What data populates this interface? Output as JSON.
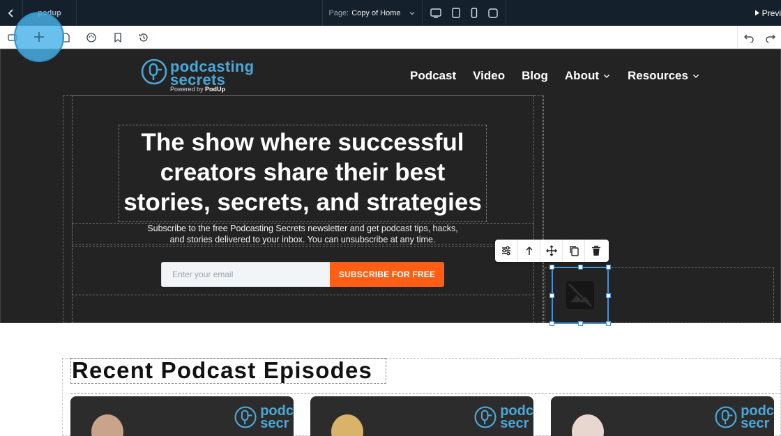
{
  "topbar": {
    "brand_label": "podup",
    "page_label": "Page:",
    "page_value": "Copy of Home",
    "preview_label": "Previ"
  },
  "site": {
    "logo_line1": "podcasting",
    "logo_line2": "secrets",
    "logo_powered": "Powered by",
    "logo_powered_brand": "PodUp",
    "nav": [
      "Podcast",
      "Video",
      "Blog",
      "About",
      "Resources"
    ]
  },
  "hero": {
    "title": "The show where successful creators share their best stories, secrets, and strategies",
    "subtitle_line1": "Subscribe to the free Podcasting Secrets newsletter and get podcast tips, hacks,",
    "subtitle_line2": "and stories delivered to your inbox. You can unsubscribe at any time.",
    "email_placeholder": "Enter your email",
    "subscribe_label": "SUBSCRIBE FOR FREE"
  },
  "episodes": {
    "title": "Recent Podcast Episodes",
    "card_logo_line1": "podc",
    "card_logo_line2": "secr"
  },
  "colors": {
    "topbar_bg": "#14202c",
    "hero_bg": "#232323",
    "accent_blue": "#4aa8d8",
    "subscribe_orange": "#ff5e14",
    "selection_blue": "#4a90d4"
  },
  "icons": {
    "topbar": [
      "chevron-left-icon",
      "desktop-icon",
      "tablet-icon",
      "mobile-icon",
      "square-icon",
      "play-icon"
    ],
    "toolbar": [
      "layers-icon",
      "plus-icon",
      "page-icon",
      "palette-icon",
      "bookmark-icon",
      "history-icon",
      "undo-icon",
      "redo-icon"
    ],
    "element_toolbar": [
      "sliders-icon",
      "arrow-up-icon",
      "move-icon",
      "copy-icon",
      "trash-icon"
    ]
  }
}
